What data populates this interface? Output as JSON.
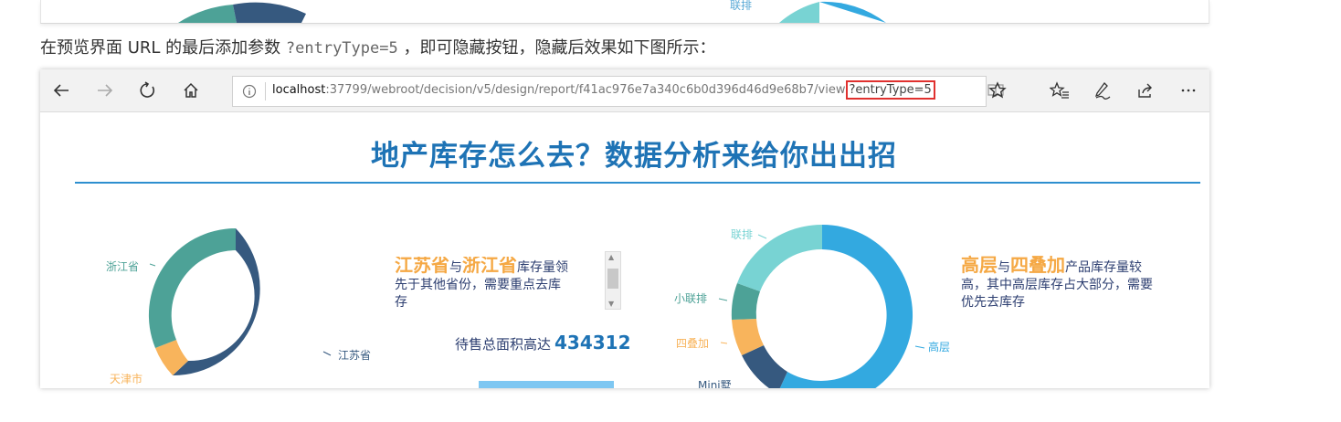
{
  "previous_strip": {
    "label": "联排"
  },
  "caption": {
    "before": "在预览界面 URL 的最后添加参数",
    "code": "?entryType=5",
    "after": "，即可隐藏按钮，隐藏后效果如下图所示："
  },
  "browser": {
    "url_host": "localhost",
    "url_path": ":37799/webroot/decision/v5/design/report/f41ac976e7a340c6b0d396d46d9e68b7/view",
    "url_param": "?entryType=5",
    "icons": [
      "back-arrow-icon",
      "forward-arrow-icon",
      "refresh-icon",
      "home-icon",
      "info-icon",
      "reading-view-icon",
      "favorite-star-icon",
      "favorites-list-icon",
      "pen-icon",
      "share-icon",
      "more-icon"
    ]
  },
  "report": {
    "title": "地产库存怎么去？数据分析来给你出出招",
    "left_text": {
      "hl1": "江苏省",
      "mid": "与",
      "hl2": "浙江省",
      "rest1": "库存量领",
      "line2": "先于其他省份，需要重点去库",
      "line3": "存"
    },
    "right_text": {
      "hl1": "高层",
      "mid": "与",
      "hl2": "四叠加",
      "rest1": "产品库存量较",
      "line2": "高，其中高层库存占大部分，需要",
      "line3": "优先去库存"
    },
    "total_label": "待售总面积高达",
    "total_value": "434312"
  },
  "chart_data": [
    {
      "type": "pie",
      "categories": [
        "江苏省",
        "天津市",
        "浙江省"
      ],
      "labels": [
        "浙江省",
        "江苏省",
        "天津市"
      ],
      "colors": {
        "江苏省": "#36597f",
        "浙江省": "#4da297",
        "天津市": "#f8b45c"
      }
    },
    {
      "type": "pie",
      "labels": [
        "联排",
        "小联排",
        "四叠加",
        "Mini墅",
        "高层"
      ],
      "colors": {
        "高层": "#33a9e0",
        "联排": "#78d3d3",
        "小联排": "#4da297",
        "四叠加": "#f8b45c",
        "Mini墅": "#36597f"
      }
    }
  ]
}
